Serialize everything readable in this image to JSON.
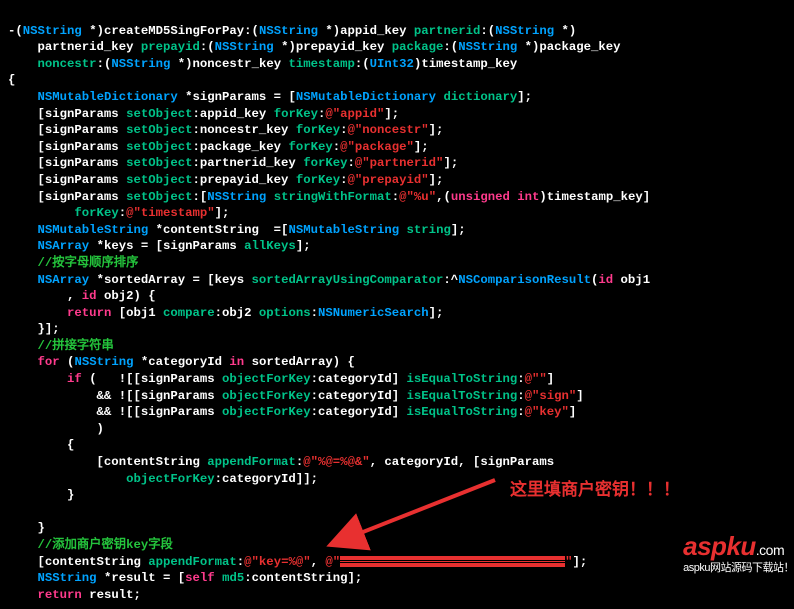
{
  "code": {
    "l1a": "-(",
    "l1b": "NSString",
    "l1c": " *)",
    "l1d": "createMD5SingForPay",
    "l1e": ":(",
    "l1f": "NSString",
    "l1g": " *)appid_key ",
    "l1h": "partnerid",
    "l1i": ":(",
    "l1j": "NSString",
    "l1k": " *)",
    "l2a": "    partnerid_key ",
    "l2b": "prepayid",
    "l2c": ":(",
    "l2d": "NSString",
    "l2e": " *)prepayid_key ",
    "l2f": "package",
    "l2g": ":(",
    "l2h": "NSString",
    "l2i": " *)package_key",
    "l3a": "    ",
    "l3b": "noncestr",
    "l3c": ":(",
    "l3d": "NSString",
    "l3e": " *)noncestr_key ",
    "l3f": "timestamp",
    "l3g": ":(",
    "l3h": "UInt32",
    "l3i": ")timestamp_key",
    "l4": "{",
    "l5a": "    ",
    "l5b": "NSMutableDictionary",
    "l5c": " *signParams = [",
    "l5d": "NSMutableDictionary",
    "l5e": " ",
    "l5f": "dictionary",
    "l5g": "];",
    "l6a": "    [signParams ",
    "l6b": "setObject",
    "l6c": ":appid_key ",
    "l6d": "forKey",
    "l6e": ":",
    "l6f": "@\"appid\"",
    "l6g": "];",
    "l7a": "    [signParams ",
    "l7b": "setObject",
    "l7c": ":noncestr_key ",
    "l7d": "forKey",
    "l7e": ":",
    "l7f": "@\"noncestr\"",
    "l7g": "];",
    "l8a": "    [signParams ",
    "l8b": "setObject",
    "l8c": ":package_key ",
    "l8d": "forKey",
    "l8e": ":",
    "l8f": "@\"package\"",
    "l8g": "];",
    "l9a": "    [signParams ",
    "l9b": "setObject",
    "l9c": ":partnerid_key ",
    "l9d": "forKey",
    "l9e": ":",
    "l9f": "@\"partnerid\"",
    "l9g": "];",
    "l10a": "    [signParams ",
    "l10b": "setObject",
    "l10c": ":prepayid_key ",
    "l10d": "forKey",
    "l10e": ":",
    "l10f": "@\"prepayid\"",
    "l10g": "];",
    "l11a": "    [signParams ",
    "l11b": "setObject",
    "l11c": ":[",
    "l11d": "NSString",
    "l11e": " ",
    "l11f": "stringWithFormat",
    "l11g": ":",
    "l11h": "@\"%u\"",
    "l11i": ",(",
    "l11j": "unsigned",
    "l11k": " ",
    "l11l": "int",
    "l11m": ")timestamp_key]",
    "l12a": "         ",
    "l12b": "forKey",
    "l12c": ":",
    "l12d": "@\"timestamp\"",
    "l12e": "];",
    "l13a": "    ",
    "l13b": "NSMutableString",
    "l13c": " *contentString  =[",
    "l13d": "NSMutableString",
    "l13e": " ",
    "l13f": "string",
    "l13g": "];",
    "l14a": "    ",
    "l14b": "NSArray",
    "l14c": " *keys = [signParams ",
    "l14d": "allKeys",
    "l14e": "];",
    "l15a": "    ",
    "l15b": "//按字母顺序排序",
    "l16a": "    ",
    "l16b": "NSArray",
    "l16c": " *sortedArray = [keys ",
    "l16d": "sortedArrayUsingComparator",
    "l16e": ":^",
    "l16f": "NSComparisonResult",
    "l16g": "(",
    "l16h": "id",
    "l16i": " obj1",
    "l17a": "        , ",
    "l17b": "id",
    "l17c": " obj2) {",
    "l18a": "        ",
    "l18b": "return",
    "l18c": " [obj1 ",
    "l18d": "compare",
    "l18e": ":obj2 ",
    "l18f": "options",
    "l18g": ":",
    "l18h": "NSNumericSearch",
    "l18i": "];",
    "l19": "    }];",
    "l20a": "    ",
    "l20b": "//拼接字符串",
    "l21a": "    ",
    "l21b": "for",
    "l21c": " (",
    "l21d": "NSString",
    "l21e": " *categoryId ",
    "l21f": "in",
    "l21g": " sortedArray) {",
    "l22a": "        ",
    "l22b": "if",
    "l22c": " (   ![[signParams ",
    "l22d": "objectForKey",
    "l22e": ":categoryId] ",
    "l22f": "isEqualToString",
    "l22g": ":",
    "l22h": "@\"\"",
    "l22i": "]",
    "l23a": "            && ![[signParams ",
    "l23b": "objectForKey",
    "l23c": ":categoryId] ",
    "l23d": "isEqualToString",
    "l23e": ":",
    "l23f": "@\"sign\"",
    "l23g": "]",
    "l24a": "            && ![[signParams ",
    "l24b": "objectForKey",
    "l24c": ":categoryId] ",
    "l24d": "isEqualToString",
    "l24e": ":",
    "l24f": "@\"key\"",
    "l24g": "]",
    "l25": "            )",
    "l26": "        {",
    "l27a": "            [contentString ",
    "l27b": "appendFormat",
    "l27c": ":",
    "l27d": "@\"%@=%@&\"",
    "l27e": ", categoryId, [signParams ",
    "l28a": "                ",
    "l28b": "objectForKey",
    "l28c": ":categoryId]];",
    "l29": "        }",
    "l30": "",
    "l31": "    }",
    "l32a": "    ",
    "l32b": "//添加商户密钥key字段",
    "l33a": "    [contentString ",
    "l33b": "appendFormat",
    "l33c": ":",
    "l33d": "@\"key=%@\"",
    "l33e": ", ",
    "l33f": "@\"",
    "l33g": "\"",
    "l33h": "];",
    "l34a": "    ",
    "l34b": "NSString",
    "l34c": " *result = [",
    "l34d": "self",
    "l34e": " ",
    "l34f": "md5",
    "l34g": ":contentString];",
    "l35a": "    ",
    "l35b": "return",
    "l35c": " result;"
  },
  "annotation": "这里填商户密钥！！！",
  "watermark": {
    "brand": "aspku",
    "dot": ".com",
    "sub": "aspku网站源码下载站！"
  }
}
